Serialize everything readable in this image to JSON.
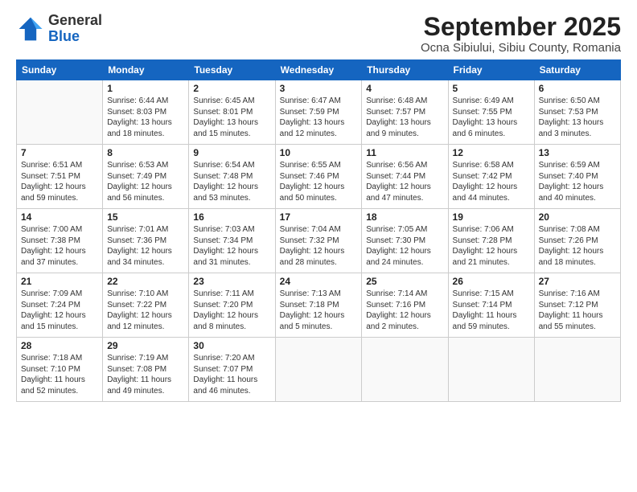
{
  "logo": {
    "text_general": "General",
    "text_blue": "Blue"
  },
  "title": "September 2025",
  "subtitle": "Ocna Sibiului, Sibiu County, Romania",
  "weekdays": [
    "Sunday",
    "Monday",
    "Tuesday",
    "Wednesday",
    "Thursday",
    "Friday",
    "Saturday"
  ],
  "weeks": [
    [
      {
        "day": "",
        "info": ""
      },
      {
        "day": "1",
        "info": "Sunrise: 6:44 AM\nSunset: 8:03 PM\nDaylight: 13 hours\nand 18 minutes."
      },
      {
        "day": "2",
        "info": "Sunrise: 6:45 AM\nSunset: 8:01 PM\nDaylight: 13 hours\nand 15 minutes."
      },
      {
        "day": "3",
        "info": "Sunrise: 6:47 AM\nSunset: 7:59 PM\nDaylight: 13 hours\nand 12 minutes."
      },
      {
        "day": "4",
        "info": "Sunrise: 6:48 AM\nSunset: 7:57 PM\nDaylight: 13 hours\nand 9 minutes."
      },
      {
        "day": "5",
        "info": "Sunrise: 6:49 AM\nSunset: 7:55 PM\nDaylight: 13 hours\nand 6 minutes."
      },
      {
        "day": "6",
        "info": "Sunrise: 6:50 AM\nSunset: 7:53 PM\nDaylight: 13 hours\nand 3 minutes."
      }
    ],
    [
      {
        "day": "7",
        "info": "Sunrise: 6:51 AM\nSunset: 7:51 PM\nDaylight: 12 hours\nand 59 minutes."
      },
      {
        "day": "8",
        "info": "Sunrise: 6:53 AM\nSunset: 7:49 PM\nDaylight: 12 hours\nand 56 minutes."
      },
      {
        "day": "9",
        "info": "Sunrise: 6:54 AM\nSunset: 7:48 PM\nDaylight: 12 hours\nand 53 minutes."
      },
      {
        "day": "10",
        "info": "Sunrise: 6:55 AM\nSunset: 7:46 PM\nDaylight: 12 hours\nand 50 minutes."
      },
      {
        "day": "11",
        "info": "Sunrise: 6:56 AM\nSunset: 7:44 PM\nDaylight: 12 hours\nand 47 minutes."
      },
      {
        "day": "12",
        "info": "Sunrise: 6:58 AM\nSunset: 7:42 PM\nDaylight: 12 hours\nand 44 minutes."
      },
      {
        "day": "13",
        "info": "Sunrise: 6:59 AM\nSunset: 7:40 PM\nDaylight: 12 hours\nand 40 minutes."
      }
    ],
    [
      {
        "day": "14",
        "info": "Sunrise: 7:00 AM\nSunset: 7:38 PM\nDaylight: 12 hours\nand 37 minutes."
      },
      {
        "day": "15",
        "info": "Sunrise: 7:01 AM\nSunset: 7:36 PM\nDaylight: 12 hours\nand 34 minutes."
      },
      {
        "day": "16",
        "info": "Sunrise: 7:03 AM\nSunset: 7:34 PM\nDaylight: 12 hours\nand 31 minutes."
      },
      {
        "day": "17",
        "info": "Sunrise: 7:04 AM\nSunset: 7:32 PM\nDaylight: 12 hours\nand 28 minutes."
      },
      {
        "day": "18",
        "info": "Sunrise: 7:05 AM\nSunset: 7:30 PM\nDaylight: 12 hours\nand 24 minutes."
      },
      {
        "day": "19",
        "info": "Sunrise: 7:06 AM\nSunset: 7:28 PM\nDaylight: 12 hours\nand 21 minutes."
      },
      {
        "day": "20",
        "info": "Sunrise: 7:08 AM\nSunset: 7:26 PM\nDaylight: 12 hours\nand 18 minutes."
      }
    ],
    [
      {
        "day": "21",
        "info": "Sunrise: 7:09 AM\nSunset: 7:24 PM\nDaylight: 12 hours\nand 15 minutes."
      },
      {
        "day": "22",
        "info": "Sunrise: 7:10 AM\nSunset: 7:22 PM\nDaylight: 12 hours\nand 12 minutes."
      },
      {
        "day": "23",
        "info": "Sunrise: 7:11 AM\nSunset: 7:20 PM\nDaylight: 12 hours\nand 8 minutes."
      },
      {
        "day": "24",
        "info": "Sunrise: 7:13 AM\nSunset: 7:18 PM\nDaylight: 12 hours\nand 5 minutes."
      },
      {
        "day": "25",
        "info": "Sunrise: 7:14 AM\nSunset: 7:16 PM\nDaylight: 12 hours\nand 2 minutes."
      },
      {
        "day": "26",
        "info": "Sunrise: 7:15 AM\nSunset: 7:14 PM\nDaylight: 11 hours\nand 59 minutes."
      },
      {
        "day": "27",
        "info": "Sunrise: 7:16 AM\nSunset: 7:12 PM\nDaylight: 11 hours\nand 55 minutes."
      }
    ],
    [
      {
        "day": "28",
        "info": "Sunrise: 7:18 AM\nSunset: 7:10 PM\nDaylight: 11 hours\nand 52 minutes."
      },
      {
        "day": "29",
        "info": "Sunrise: 7:19 AM\nSunset: 7:08 PM\nDaylight: 11 hours\nand 49 minutes."
      },
      {
        "day": "30",
        "info": "Sunrise: 7:20 AM\nSunset: 7:07 PM\nDaylight: 11 hours\nand 46 minutes."
      },
      {
        "day": "",
        "info": ""
      },
      {
        "day": "",
        "info": ""
      },
      {
        "day": "",
        "info": ""
      },
      {
        "day": "",
        "info": ""
      }
    ]
  ]
}
